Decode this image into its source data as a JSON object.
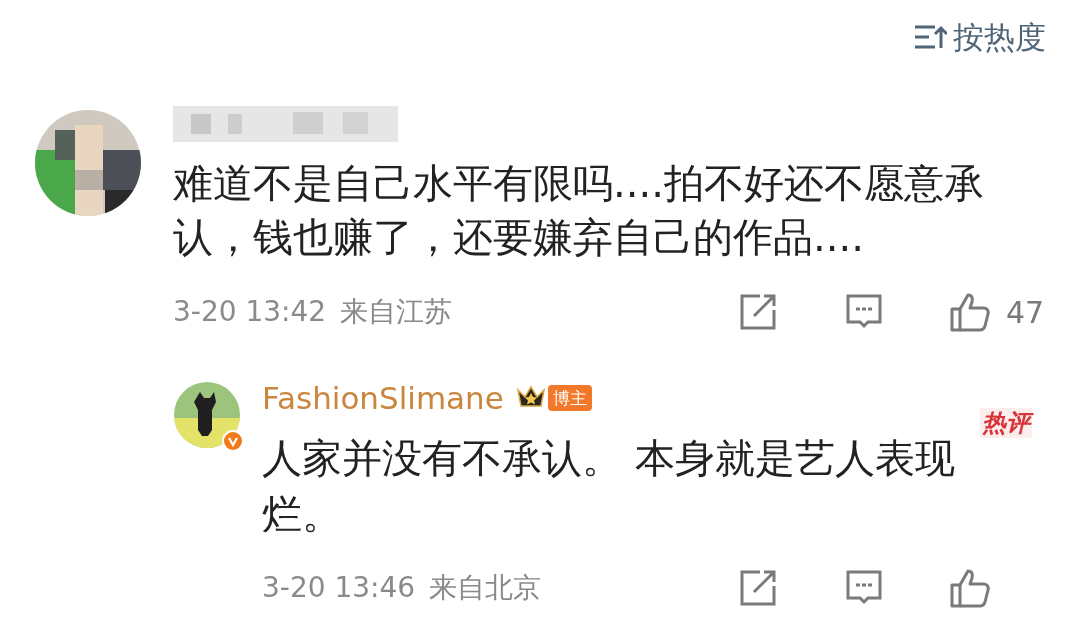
{
  "sort_button": {
    "label": "按热度"
  },
  "comment": {
    "text_lines": [
      "难道不是自己水平有限吗....拍不好还不愿意承",
      "认，钱也赚了，还要嫌弃自己的作品...."
    ],
    "time": "3-20 13:42",
    "location": "来自江苏",
    "likes": "47"
  },
  "reply": {
    "author": "FashionSlimane",
    "verified": true,
    "badge": "博主",
    "hot_label": "热评",
    "text_lines": [
      "人家并没有不承认。 本身就是艺人表现",
      "烂。"
    ],
    "time": "3-20 13:46",
    "location": "来自北京"
  }
}
